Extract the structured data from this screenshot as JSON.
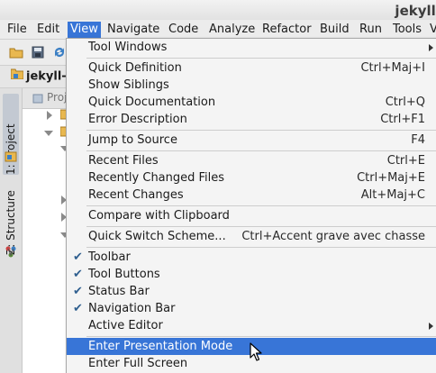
{
  "window": {
    "title": "jekyll-"
  },
  "menubar": {
    "items": [
      {
        "label": "File",
        "active": false
      },
      {
        "label": "Edit",
        "active": false
      },
      {
        "label": "View",
        "active": true
      },
      {
        "label": "Navigate",
        "active": false
      },
      {
        "label": "Code",
        "active": false
      },
      {
        "label": "Analyze",
        "active": false
      },
      {
        "label": "Refactor",
        "active": false
      },
      {
        "label": "Build",
        "active": false
      },
      {
        "label": "Run",
        "active": false
      },
      {
        "label": "Tools",
        "active": false
      },
      {
        "label": "V",
        "active": false
      }
    ]
  },
  "toolbar": {
    "buttons": [
      {
        "icon": "open-folder-icon"
      },
      {
        "icon": "save-icon"
      },
      {
        "icon": "sync-icon"
      }
    ]
  },
  "navbar": {
    "crumb": "jekyll-"
  },
  "sidebar": {
    "tabs": [
      {
        "label": "1: Project",
        "active": true
      },
      {
        "label": "Z: Structure",
        "active": false
      }
    ]
  },
  "project_panel": {
    "header_label": "Proj"
  },
  "view_menu": {
    "items": [
      {
        "label": "Tool Windows",
        "shortcut": "",
        "checked": false,
        "submenu": true
      },
      {
        "label": "Quick Definition",
        "shortcut": "Ctrl+Maj+I",
        "checked": false,
        "submenu": false
      },
      {
        "label": "Show Siblings",
        "shortcut": "",
        "checked": false,
        "submenu": false
      },
      {
        "label": "Quick Documentation",
        "shortcut": "Ctrl+Q",
        "checked": false,
        "submenu": false
      },
      {
        "label": "Error Description",
        "shortcut": "Ctrl+F1",
        "checked": false,
        "submenu": false
      },
      {
        "label": "Jump to Source",
        "shortcut": "F4",
        "checked": false,
        "submenu": false
      },
      {
        "label": "Recent Files",
        "shortcut": "Ctrl+E",
        "checked": false,
        "submenu": false
      },
      {
        "label": "Recently Changed Files",
        "shortcut": "Ctrl+Maj+E",
        "checked": false,
        "submenu": false
      },
      {
        "label": "Recent Changes",
        "shortcut": "Alt+Maj+C",
        "checked": false,
        "submenu": false
      },
      {
        "label": "Compare with Clipboard",
        "shortcut": "",
        "checked": false,
        "submenu": false
      },
      {
        "label": "Quick Switch Scheme...",
        "shortcut": "Ctrl+Accent grave avec chasse",
        "checked": false,
        "submenu": false
      },
      {
        "label": "Toolbar",
        "shortcut": "",
        "checked": true,
        "submenu": false
      },
      {
        "label": "Tool Buttons",
        "shortcut": "",
        "checked": true,
        "submenu": false
      },
      {
        "label": "Status Bar",
        "shortcut": "",
        "checked": true,
        "submenu": false
      },
      {
        "label": "Navigation Bar",
        "shortcut": "",
        "checked": true,
        "submenu": false
      },
      {
        "label": "Active Editor",
        "shortcut": "",
        "checked": false,
        "submenu": true
      },
      {
        "label": "Enter Presentation Mode",
        "shortcut": "",
        "checked": false,
        "submenu": false,
        "highlighted": true
      },
      {
        "label": "Enter Full Screen",
        "shortcut": "",
        "checked": false,
        "submenu": false
      }
    ]
  },
  "colors": {
    "highlight": "#3875d7",
    "check": "#2f5f8f"
  }
}
